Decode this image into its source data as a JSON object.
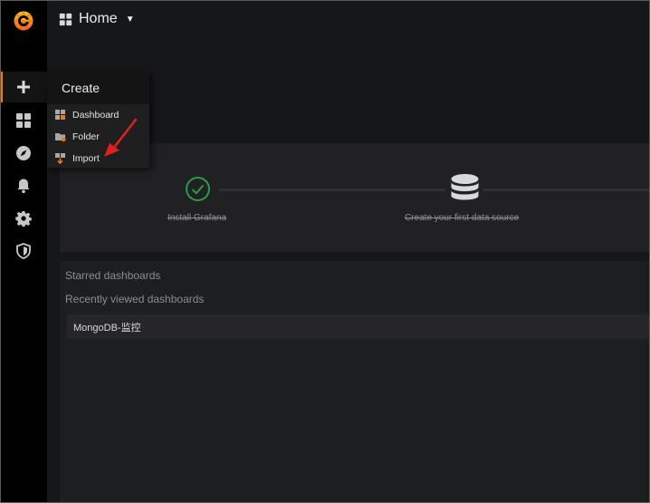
{
  "header": {
    "title": "Home"
  },
  "create_menu": {
    "title": "Create",
    "items": [
      {
        "label": "Dashboard",
        "icon": "dashboard-new-icon"
      },
      {
        "label": "Folder",
        "icon": "folder-new-icon"
      },
      {
        "label": "Import",
        "icon": "import-icon"
      }
    ]
  },
  "getting_started": {
    "steps": [
      {
        "label": "Install Grafana",
        "icon": "check-circle-icon",
        "completed": true
      },
      {
        "label": "Create your first data source",
        "icon": "database-icon",
        "completed": true
      }
    ]
  },
  "dashboards": {
    "starred_title": "Starred dashboards",
    "recent_title": "Recently viewed dashboards",
    "recent_items": [
      "MongoDB-监控"
    ]
  },
  "colors": {
    "accent": "#eb7b18",
    "success": "#299c46",
    "annotation_arrow": "#e02020"
  }
}
